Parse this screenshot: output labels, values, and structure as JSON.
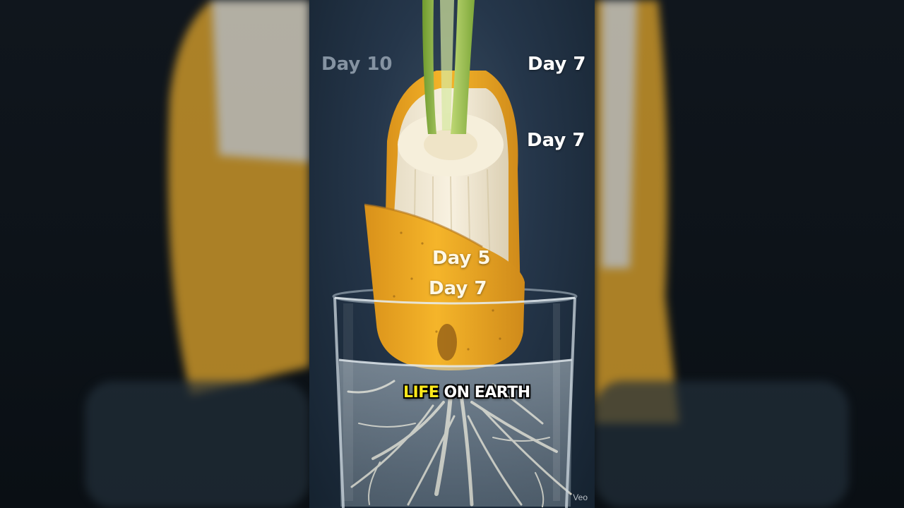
{
  "overlay_labels": {
    "day10": "Day 10",
    "day7_top": "Day 7",
    "day7_mid": "Day 7",
    "day5": "Day 5",
    "day7_low": "Day 7"
  },
  "caption": {
    "highlight": "LIFE",
    "rest": "ON EARTH"
  },
  "watermark": "Veo",
  "colors": {
    "background": "#0b1118",
    "frame_bg": "#25364a",
    "banana_peel": "#f2b124",
    "banana_flesh": "#f4ecd6",
    "sprout": "#a7c95a",
    "caption_highlight": "#ffe81a"
  }
}
